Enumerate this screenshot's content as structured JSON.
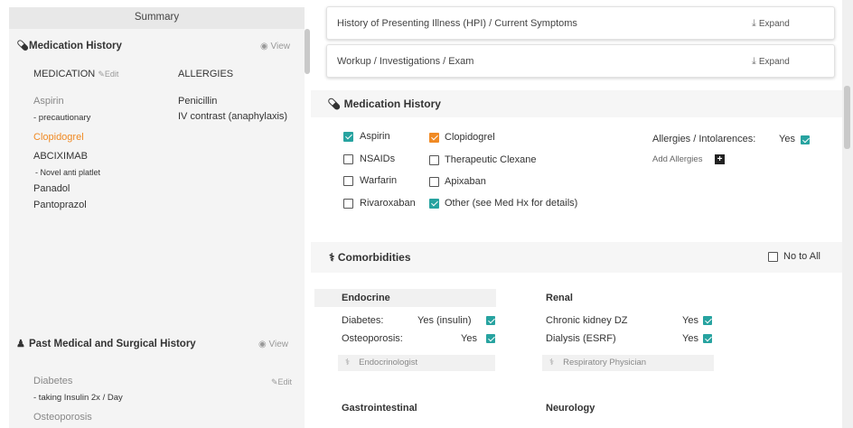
{
  "summary": {
    "title": "Summary",
    "medication_history": {
      "title": "Medication History",
      "view": "View",
      "col_medication": "MEDICATION",
      "edit": "Edit",
      "col_allergies": "ALLERGIES",
      "medications": [
        {
          "name": "Aspirin",
          "note": "- precautionary"
        },
        {
          "name": "Clopidogrel",
          "note": ""
        },
        {
          "name": "ABCIXIMAB",
          "note": "- Novel anti platlet"
        },
        {
          "name": "Panadol",
          "note": ""
        },
        {
          "name": "Pantoprazol",
          "note": ""
        }
      ],
      "allergies": [
        "Penicillin",
        "IV contrast (anaphylaxis)"
      ]
    },
    "past_history": {
      "title": "Past Medical and Surgical History",
      "view": "View",
      "edit": "Edit",
      "items": [
        {
          "name": "Diabetes",
          "note": "- taking Insulin 2x / Day"
        },
        {
          "name": "Osteoporosis",
          "note": ""
        }
      ]
    }
  },
  "main": {
    "cards": [
      {
        "title": "History of Presenting Illness (HPI) / Current Symptoms",
        "action": "Expand"
      },
      {
        "title": "Workup / Investigations / Exam",
        "action": "Expand"
      }
    ],
    "medication_history": {
      "title": "Medication History",
      "checkboxes": [
        {
          "label": "Aspirin",
          "checked": true
        },
        {
          "label": "Clopidogrel",
          "checked": true
        },
        {
          "label": "NSAIDs",
          "checked": false
        },
        {
          "label": "Therapeutic Clexane",
          "checked": false
        },
        {
          "label": "Warfarin",
          "checked": false
        },
        {
          "label": "Apixaban",
          "checked": false
        },
        {
          "label": "Rivaroxaban",
          "checked": false
        },
        {
          "label": "Other (see Med Hx for details)",
          "checked": true
        }
      ],
      "allergies_label": "Allergies / Intolarences:",
      "allergies_value": "Yes",
      "add_allergies": "Add Allergies"
    },
    "comorbidities": {
      "title": "Comorbidities",
      "no_to_all": "No to All",
      "endocrine": {
        "title": "Endocrine",
        "rows": [
          {
            "label": "Diabetes:",
            "value": "Yes (insulin)"
          },
          {
            "label": "Osteoporosis:",
            "value": "Yes"
          }
        ],
        "specialist": "Endocrinologist"
      },
      "renal": {
        "title": "Renal",
        "rows": [
          {
            "label": "Chronic kidney DZ",
            "value": "Yes"
          },
          {
            "label": "Dialysis (ESRF)",
            "value": "Yes"
          }
        ],
        "specialist": "Respiratory Physician"
      },
      "gastrointestinal": {
        "title": "Gastrointestinal"
      },
      "neurology": {
        "title": "Neurology"
      }
    }
  },
  "colors": {
    "accent_teal": "#27a3a0",
    "accent_orange": "#f08a24"
  }
}
